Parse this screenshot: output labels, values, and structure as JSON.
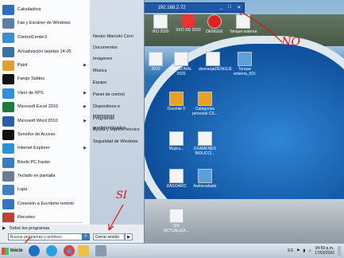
{
  "remote_toolbar": {
    "address": "192.168.2.72",
    "controls": [
      "_",
      "□",
      "✕"
    ]
  },
  "desktop_icons": [
    "IXO 2020",
    "SXO SD 2020",
    "DENGUE",
    "Tanque externa",
    "2020",
    "PERSONAL 2020",
    "descargaDENGUE",
    "Tanque externa_001",
    "Docente F",
    "Categorias personal CS...",
    "Mujica...",
    "EXAMENES INDUCCI...",
    "DASOARO",
    "Autoevaluate",
    "SIS ACTUALIZA..."
  ],
  "start_menu": {
    "pinned": [
      {
        "label": "Calculadora",
        "color": "#2d6fbf"
      },
      {
        "label": "Fax y Escáner de Windows",
        "color": "#5c7fa8"
      },
      {
        "label": "ControlCenter3",
        "color": "#3a8ed1"
      },
      {
        "label": "Actualización tarjetas 14-05",
        "color": "#3c6fa2"
      },
      {
        "label": "Paint",
        "color": "#e0a030",
        "submenu": true
      },
      {
        "label": "Fango Saldos",
        "color": "#111111"
      },
      {
        "label": "Visor de XPS",
        "color": "#2f8fd8",
        "submenu": true
      },
      {
        "label": "Microsoft Excel 2010",
        "color": "#1e7a3c",
        "submenu": true
      },
      {
        "label": "Microsoft Word 2010",
        "color": "#2a5caa",
        "submenu": true
      },
      {
        "label": "Servidor de Acceso",
        "color": "#111111"
      },
      {
        "label": "Internet Explorer",
        "color": "#2c8fd9",
        "submenu": true
      },
      {
        "label": "Bixolo PC Faxter",
        "color": "#3b7bc5"
      },
      {
        "label": "Teclado en pantalla",
        "color": "#6a7d93"
      },
      {
        "label": "Lupa",
        "color": "#3f7fc2"
      },
      {
        "label": "Conexión a Escritorio remoto",
        "color": "#3575c0"
      },
      {
        "label": "Recortes",
        "color": "#c23c3c"
      }
    ],
    "all_programs": "Todos los programas",
    "search_placeholder": "Buscar programas y archivos",
    "right_items": [
      "Nestor Marcelo Cerri",
      "Documentos",
      "Imágenes",
      "Música",
      "Equipo",
      "Panel de control",
      "Dispositivos e impresoras",
      "Programas predeterminados",
      "Ayuda y soporte técnico",
      "Seguridad de Windows"
    ],
    "shutdown_label": "Cerrar sesión"
  },
  "annotations": {
    "no": "NO",
    "si": "SI"
  },
  "taskbar": {
    "start_label": "Inicio",
    "lang": "ES",
    "time": "04:59 p.m.",
    "date": "17/03/2020"
  }
}
